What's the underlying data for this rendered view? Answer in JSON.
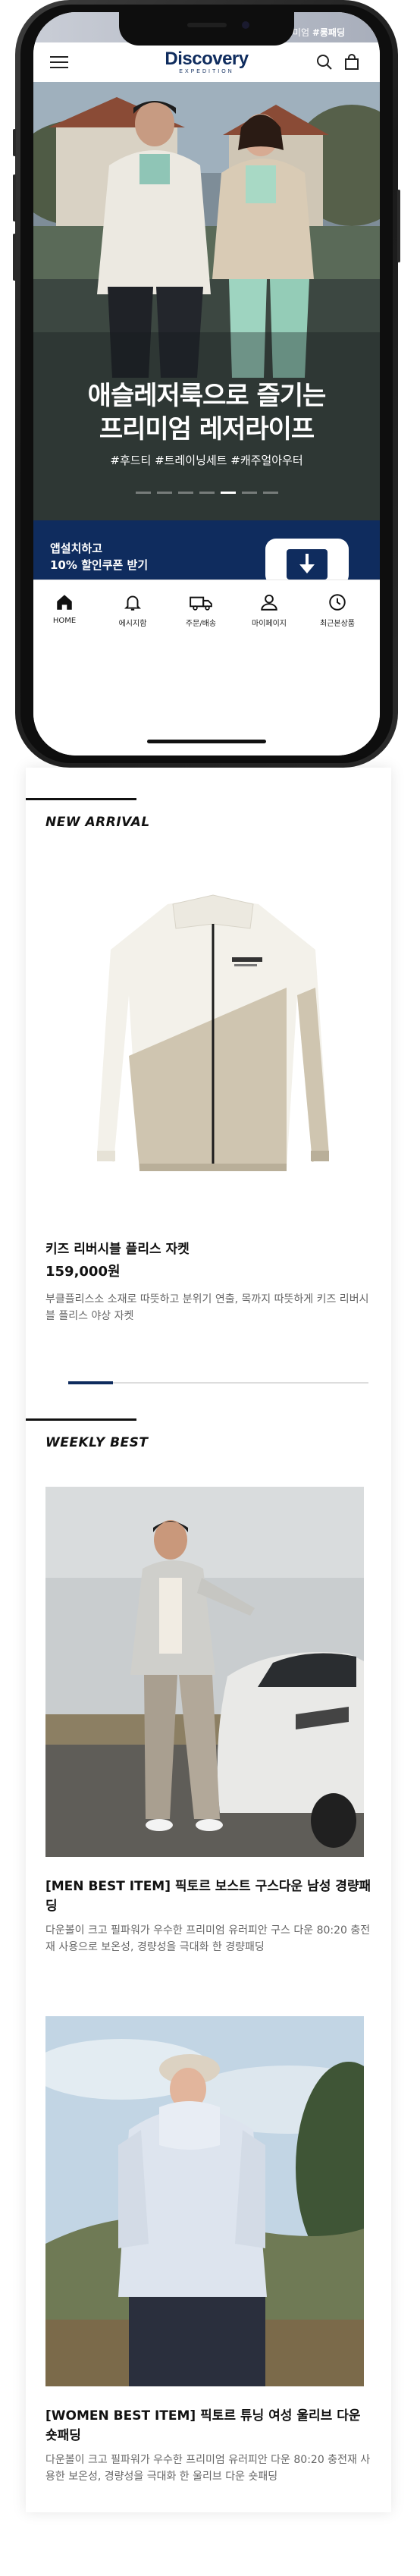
{
  "top_banner": {
    "text": "온몸을 감싸는 프리미엄 ",
    "highlight": "#롱패딩"
  },
  "brand": {
    "name": "Discovery",
    "sub": "EXPEDITION",
    "color": "#0f2c5e"
  },
  "hero": {
    "title": "애슬레저룩으로 즐기는\n프리미엄 레저라이프",
    "tags": "#후드티 #트레이닝세트 #캐주얼아우터",
    "slide_count": 7,
    "active_slide": 5
  },
  "app_banner": {
    "text": "앱설치하고\n10% 할인쿠폰 받기"
  },
  "tabbar": {
    "items": [
      {
        "label": "HOME",
        "icon": "home-icon"
      },
      {
        "label": "에시지함",
        "icon": "bell-icon"
      },
      {
        "label": "주문/배송",
        "icon": "truck-icon"
      },
      {
        "label": "마이페이지",
        "icon": "user-icon"
      },
      {
        "label": "최근본상품",
        "icon": "clock-icon"
      }
    ]
  },
  "new_arrival": {
    "title": "NEW ARRIVAL",
    "product": {
      "name": "키즈 리버시블 플리스 자켓",
      "price": "159,000원",
      "description": "부클플리스소 소재로 따뜻하고 분위기 연출, 목까지 따뜻하게 키즈 리버시블 플리스 야상 자켓"
    },
    "carousel_progress": 0.15
  },
  "weekly_best": {
    "title": "WEEKLY BEST",
    "items": [
      {
        "title": "[MEN BEST ITEM] 픽토르 보스트 구스다운 남성 경량패딩",
        "description": "다운볼이 크고 필파워가 우수한 프리미엄 유러피안 구스 다운 80:20 충전재 사용으로 보온성, 경량성을 극대화 한 경량패딩"
      },
      {
        "title": "[WOMEN BEST ITEM] 픽토르 튜닝 여성 울리브 다운 숏패딩",
        "description": "다운볼이 크고 필파워가 우수한 프리미엄 유러피안 다운 80:20 충전재 사용한 보온성, 경량성을 극대화 한 울리브 다운 숏패딩"
      }
    ]
  }
}
